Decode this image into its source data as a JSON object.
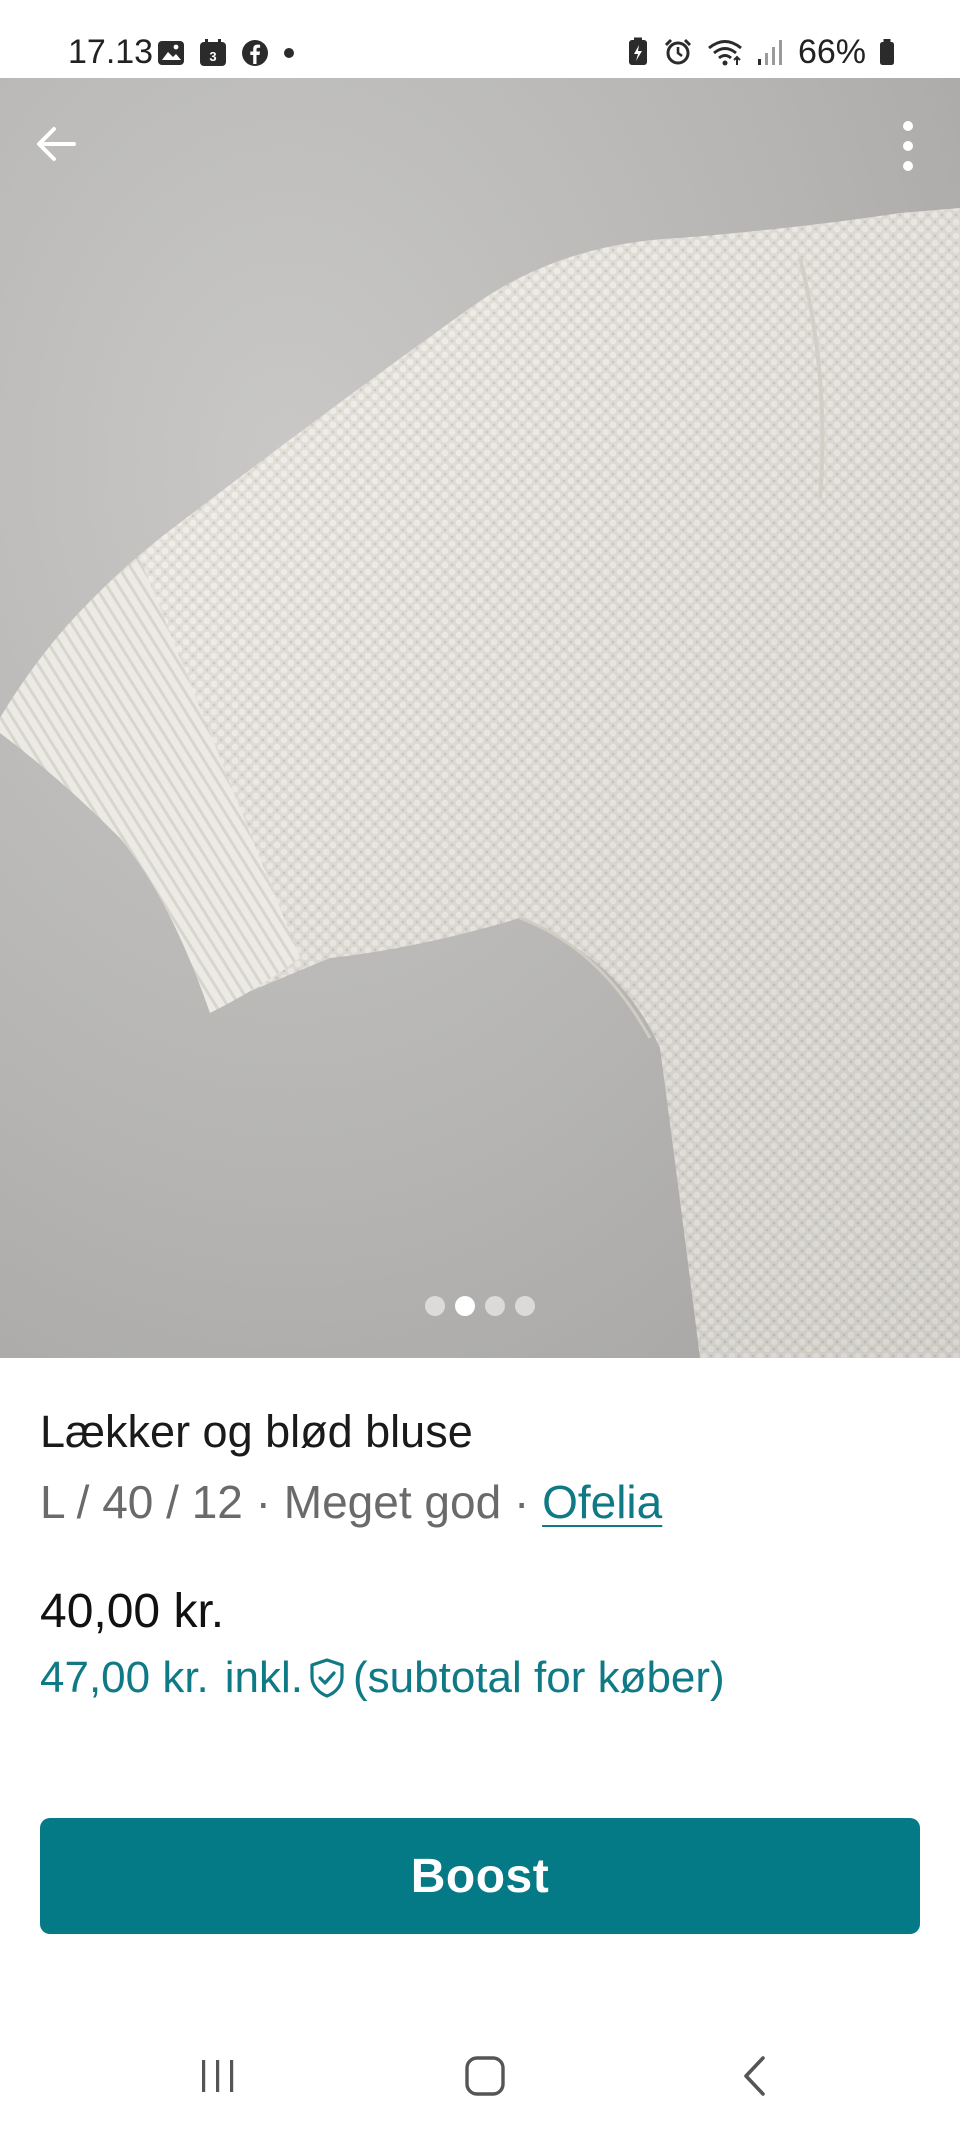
{
  "status_bar": {
    "time": "17.13",
    "battery": "66%"
  },
  "icons": {
    "back": "back-arrow-icon",
    "more": "more-vertical-icon",
    "shield": "buyer-protection-shield-icon",
    "nav_recents": "recents-icon",
    "nav_home": "home-icon",
    "nav_back": "nav-back-icon"
  },
  "carousel": {
    "count": 4,
    "active_index": 1
  },
  "listing": {
    "title": "Lækker og blød bluse",
    "size": "L / 40 / 12",
    "separator": " · ",
    "condition": "Meget god",
    "brand": "Ofelia",
    "price": "40,00 kr.",
    "price_incl_amount": "47,00 kr.",
    "price_incl_label": "inkl.",
    "price_incl_note": "(subtotal for køber)"
  },
  "actions": {
    "boost_label": "Boost"
  },
  "colors": {
    "accent": "#047a86",
    "link": "#0f7a86",
    "muted_text": "#6a6a6a"
  }
}
